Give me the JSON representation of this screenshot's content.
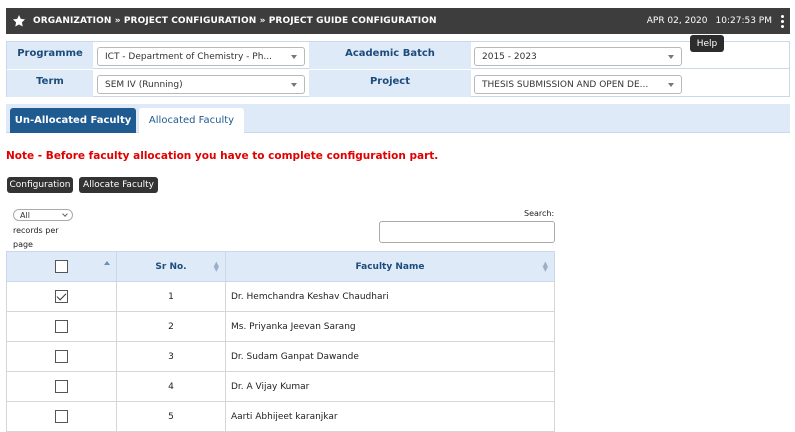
{
  "topbar": {
    "breadcrumb": "ORGANIZATION » PROJECT CONFIGURATION » PROJECT GUIDE CONFIGURATION",
    "date": "APR 02, 2020",
    "time": "10:27:53 PM"
  },
  "filters": {
    "programme_label": "Programme",
    "programme_value": "ICT - Department of Chemistry - Ph...",
    "academic_batch_label": "Academic Batch",
    "academic_batch_value": "2015 - 2023",
    "term_label": "Term",
    "term_value": "SEM IV (Running)",
    "project_label": "Project",
    "project_value": "THESIS SUBMISSION AND OPEN DE...",
    "help_label": "Help"
  },
  "tabs": [
    {
      "label": "Un-Allocated Faculty",
      "active": true
    },
    {
      "label": "Allocated Faculty",
      "active": false
    }
  ],
  "note": "Note - Before faculty allocation you have to complete configuration part.",
  "buttons": {
    "configuration": "Configuration",
    "allocate_faculty": "Allocate Faculty"
  },
  "records": {
    "selected": "All",
    "label": "records per page"
  },
  "search": {
    "label": "Search:",
    "value": ""
  },
  "table": {
    "headers": [
      "Sr No.",
      "Faculty Name"
    ],
    "rows": [
      {
        "checked": true,
        "sr": "1",
        "name": "Dr. Hemchandra Keshav Chaudhari"
      },
      {
        "checked": false,
        "sr": "2",
        "name": "Ms. Priyanka Jeevan Sarang"
      },
      {
        "checked": false,
        "sr": "3",
        "name": "Dr. Sudam Ganpat Dawande"
      },
      {
        "checked": false,
        "sr": "4",
        "name": "Dr. A Vijay Kumar"
      },
      {
        "checked": false,
        "sr": "5",
        "name": "Aarti Abhijeet karanjkar"
      }
    ]
  }
}
